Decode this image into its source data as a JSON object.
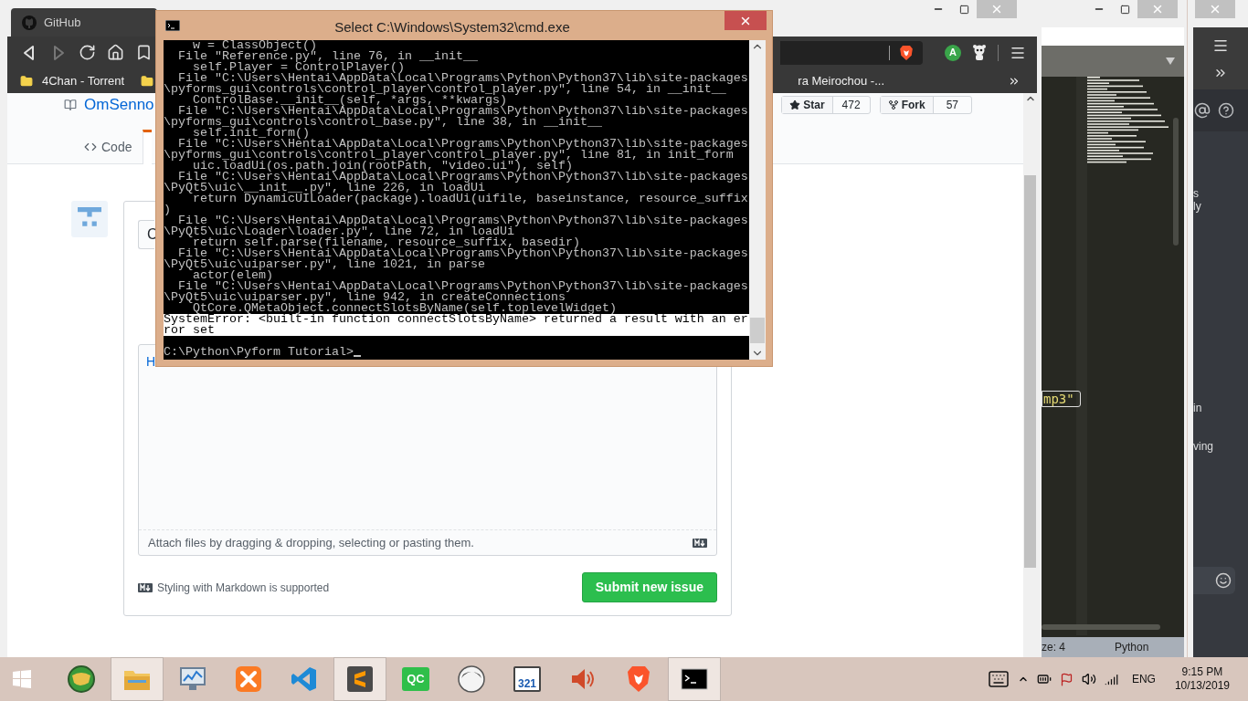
{
  "browser": {
    "tab_title": "GitHub",
    "bookmarks": {
      "first": "4Chan - Torrent",
      "last": "ra Meirochou -..."
    },
    "account_initial": "A",
    "page": {
      "repo_name": "OmSenno",
      "star_label": "Star",
      "star_count": "472",
      "fork_label": "Fork",
      "fork_count": "57",
      "tabs": [
        {
          "label": "Code",
          "selected": false
        },
        {
          "selected": true
        }
      ]
    },
    "issue_form": {
      "title_value": "C",
      "body_value": "H",
      "attach_hint": "Attach files by dragging & dropping, selecting or pasting them.",
      "markdown_note": "Styling with Markdown is supported",
      "submit_label": "Submit new issue"
    }
  },
  "cmd": {
    "title": "Select C:\\Windows\\System32\\cmd.exe",
    "lines": [
      {
        "text": "    w = ClassObject()",
        "selected": false
      },
      {
        "text": "  File \"Reference.py\", line 76, in __init__",
        "selected": false
      },
      {
        "text": "    self.Player = ControlPlayer()",
        "selected": false
      },
      {
        "text": "  File \"C:\\Users\\Hentai\\AppData\\Local\\Programs\\Python\\Python37\\lib\\site-packages",
        "selected": false
      },
      {
        "text": "\\pyforms_gui\\controls\\control_player\\control_player.py\", line 54, in __init__",
        "selected": false
      },
      {
        "text": "    ControlBase.__init__(self, *args, **kwargs)",
        "selected": false
      },
      {
        "text": "  File \"C:\\Users\\Hentai\\AppData\\Local\\Programs\\Python\\Python37\\lib\\site-packages",
        "selected": false
      },
      {
        "text": "\\pyforms_gui\\controls\\control_base.py\", line 38, in __init__",
        "selected": false
      },
      {
        "text": "    self.init_form()",
        "selected": false
      },
      {
        "text": "  File \"C:\\Users\\Hentai\\AppData\\Local\\Programs\\Python\\Python37\\lib\\site-packages",
        "selected": false
      },
      {
        "text": "\\pyforms_gui\\controls\\control_player\\control_player.py\", line 81, in init_form",
        "selected": false
      },
      {
        "text": "    uic.loadUi(os.path.join(rootPath, \"video.ui\"), self)",
        "selected": false
      },
      {
        "text": "  File \"C:\\Users\\Hentai\\AppData\\Local\\Programs\\Python\\Python37\\lib\\site-packages",
        "selected": false
      },
      {
        "text": "\\PyQt5\\uic\\__init__.py\", line 226, in loadUi",
        "selected": false
      },
      {
        "text": "    return DynamicUILoader(package).loadUi(uifile, baseinstance, resource_suffix",
        "selected": false
      },
      {
        "text": ")",
        "selected": false
      },
      {
        "text": "  File \"C:\\Users\\Hentai\\AppData\\Local\\Programs\\Python\\Python37\\lib\\site-packages",
        "selected": false
      },
      {
        "text": "\\PyQt5\\uic\\Loader\\loader.py\", line 72, in loadUi",
        "selected": false
      },
      {
        "text": "    return self.parse(filename, resource_suffix, basedir)",
        "selected": false
      },
      {
        "text": "  File \"C:\\Users\\Hentai\\AppData\\Local\\Programs\\Python\\Python37\\lib\\site-packages",
        "selected": false
      },
      {
        "text": "\\PyQt5\\uic\\uiparser.py\", line 1021, in parse",
        "selected": false
      },
      {
        "text": "    actor(elem)",
        "selected": false
      },
      {
        "text": "  File \"C:\\Users\\Hentai\\AppData\\Local\\Programs\\Python\\Python37\\lib\\site-packages",
        "selected": false
      },
      {
        "text": "\\PyQt5\\uic\\uiparser.py\", line 942, in createConnections",
        "selected": false
      },
      {
        "text": "    QtCore.QMetaObject.connectSlotsByName(self.toplevelWidget)",
        "selected": false
      },
      {
        "text": "SystemError: <built-in function connectSlotsByName> returned a result with an er",
        "selected": true
      },
      {
        "text": "ror set",
        "selected": true
      }
    ],
    "prompt": "C:\\Python\\Pyform Tutorial>"
  },
  "editor": {
    "snippet": "mp3\"",
    "status_left": "ze: 4",
    "syntax": "Python"
  },
  "chat": {
    "fragments": [
      "s",
      "ly",
      "in",
      "ving"
    ]
  },
  "taskbar": {
    "apps": [
      {
        "kind": "start",
        "selected": false
      },
      {
        "kind": "globe",
        "selected": false
      },
      {
        "kind": "explorer",
        "selected": true
      },
      {
        "kind": "monitor",
        "selected": false
      },
      {
        "kind": "xampp",
        "selected": false
      },
      {
        "kind": "vscode",
        "selected": false
      },
      {
        "kind": "sublime",
        "selected": true
      },
      {
        "kind": "qc",
        "label": "QC",
        "selected": false
      },
      {
        "kind": "avatar",
        "selected": false
      },
      {
        "kind": "media",
        "label": "321",
        "selected": false
      },
      {
        "kind": "speaker",
        "selected": false
      },
      {
        "kind": "brave",
        "selected": false
      },
      {
        "kind": "cmd",
        "selected": true
      }
    ],
    "language": "ENG",
    "time": "9:15 PM",
    "date": "10/13/2019"
  }
}
